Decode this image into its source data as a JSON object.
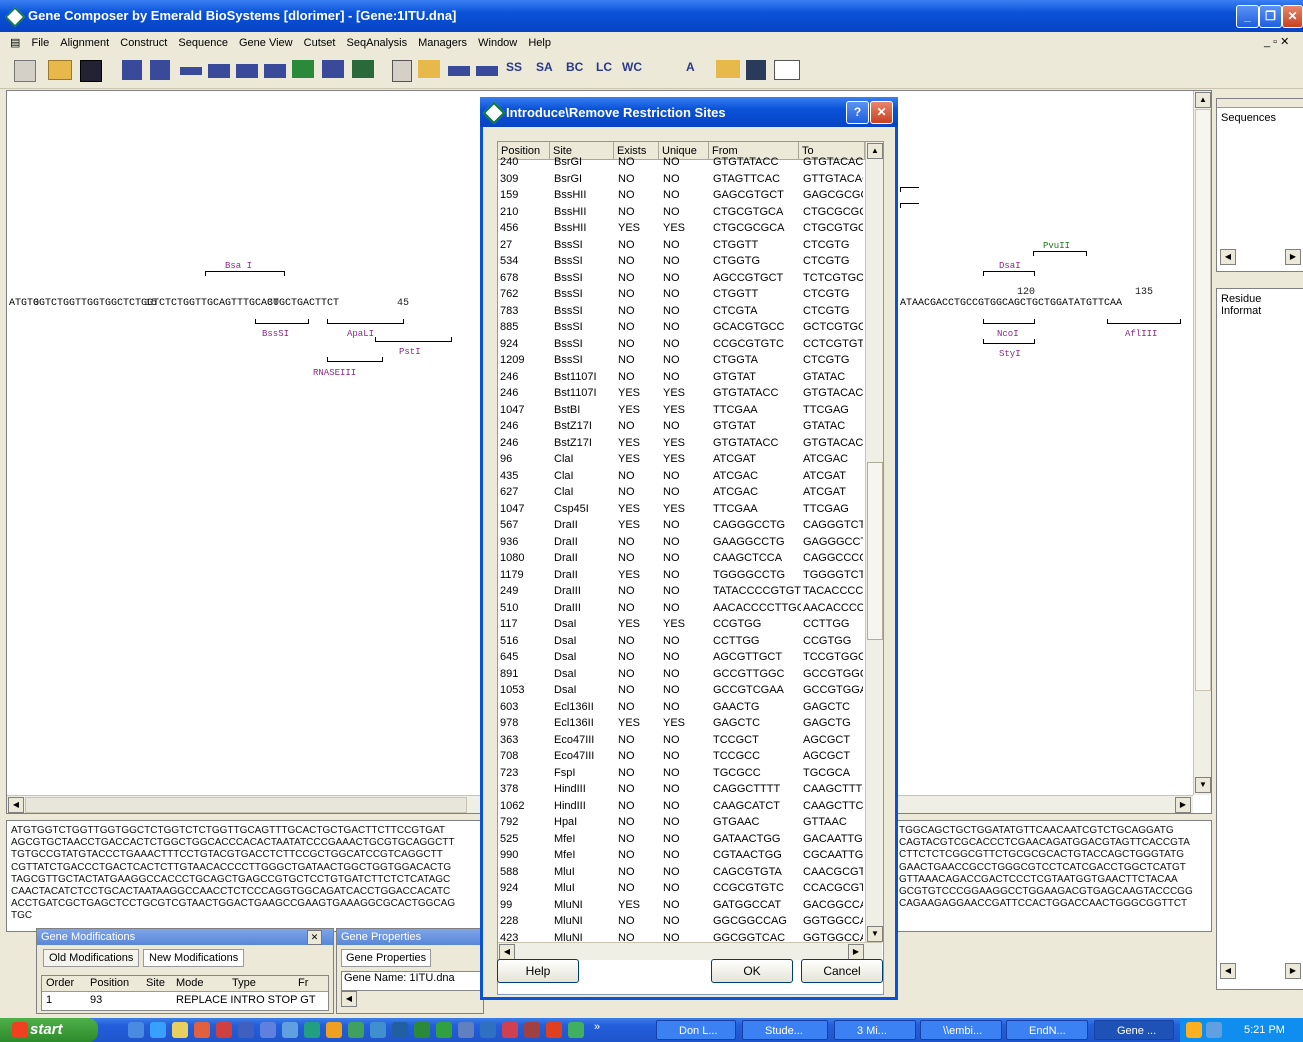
{
  "window": {
    "title": "Gene Composer by Emerald BioSystems [dlorimer] - [Gene:1ITU.dna]"
  },
  "menu": [
    "File",
    "Alignment",
    "Construct",
    "Sequence",
    "Gene View",
    "Cutset",
    "SeqAnalysis",
    "Managers",
    "Window",
    "Help"
  ],
  "toolbar_text": [
    "SS",
    "SA",
    "BC",
    "LC",
    "WC",
    "A"
  ],
  "sequence_view": {
    "sequence_left": "ATGTGGTCTGGTTGGTGGCTCTGGTCTCTGGTTGCAGTTTGCACTGCTGACTTCT",
    "sequence_right": "ATAACGACCTGCCGTGGCAGCTGCTGGATATGTTCAA",
    "ticks": [
      "0",
      "15",
      "30",
      "45",
      "120",
      "135"
    ],
    "sites": [
      "Bsa I",
      "BssSI",
      "ApaLI",
      "PstI",
      "RNASEIII",
      "PvuII",
      "DsaI",
      "NcoI",
      "StyI",
      "AflIII"
    ]
  },
  "right_panels": {
    "sequences": "Sequences",
    "residue": "Residue Informat"
  },
  "dna_lines_left": [
    "ATGTGGTCTGGTTGGTGGCTCTGGTCTCTGGTTGCAGTTTGCACTGCTGACTTCTTCCGTGAT",
    "AGCGTGCTAACCTGACCACTCTGGCTGGCACCCACACTAATATCCCGAAACTGCGTGCAGGCTT",
    "TGTGCCGTATGTACCCTGAAACTTTCCTGTACGTGACCTCTTCCGCTGGCATCCGTCAGGCTT",
    "CGTTATCTGACCCTGACTCACTCTTGTAACACCCCTTGGGCTGATAACTGGCTGGTGGACACTG",
    "TAGCGTTGCTACTATGAAGGCCACCCTGCAGCTGAGCCGTGCTCCTGTGATCTTCTCTCATAGC",
    "CAACTACATCTCCTGCACTAATAAGGCCAACCTCTCCCAGGTGGCAGATCACCTGGACCACATC",
    "ACCTGATCGCTGAGCTCCTGCGTCGTAACTGGACTGAAGCCGAAGTGAAAGGCGCACTGGCAG",
    "TGC"
  ],
  "dna_lines_right": [
    "TGGCAGCTGCTGGATATGTTCAACAATCGTCTGCAGGATG",
    "CAGTACGTCGCACCCTCGAACAGATGGACGTAGTTCACCGTA",
    "CTTCTCTCGGCGTTCTGCGCGCACTGTACCAGCTGGGTATG",
    "GAACTGAACCGCCTGGGCGTCCTCATCGACCTGGCTCATGT",
    "GTTAAACAGACCGACTCCCTCGTAATGGTGAACTTCTACAA",
    "GCGTGTCCCGGAAGGCCTGGAAGACGTGAGCAAGTACCCGG",
    "CAGAAGAGGAACCGATTCCACTGGACCAACTGGGCGGTTCT"
  ],
  "dialog": {
    "title": "Introduce\\Remove Restriction Sites",
    "columns": [
      "Position",
      "Site",
      "Exists",
      "Unique",
      "From",
      "To"
    ],
    "rows": [
      [
        "240",
        "BsrGI",
        "NO",
        "NO",
        "GTGTATACC",
        "GTGTACACC"
      ],
      [
        "309",
        "BsrGI",
        "NO",
        "NO",
        "GTAGTTCAC",
        "GTTGTACAC"
      ],
      [
        "159",
        "BssHII",
        "NO",
        "NO",
        "GAGCGTGCT",
        "GAGCGCGC"
      ],
      [
        "210",
        "BssHII",
        "NO",
        "NO",
        "CTGCGTGCA",
        "CTGCGCGC"
      ],
      [
        "456",
        "BssHII",
        "YES",
        "YES",
        "CTGCGCGCA",
        "CTGCGTGC"
      ],
      [
        "27",
        "BssSI",
        "NO",
        "NO",
        "CTGGTT",
        "CTCGTG"
      ],
      [
        "534",
        "BssSI",
        "NO",
        "NO",
        "CTGGTG",
        "CTCGTG"
      ],
      [
        "678",
        "BssSI",
        "NO",
        "NO",
        "AGCCGTGCT",
        "TCTCGTGC"
      ],
      [
        "762",
        "BssSI",
        "NO",
        "NO",
        "CTGGTT",
        "CTCGTG"
      ],
      [
        "783",
        "BssSI",
        "NO",
        "NO",
        "CTCGTA",
        "CTCGTG"
      ],
      [
        "885",
        "BssSI",
        "NO",
        "NO",
        "GCACGTGCC",
        "GCTCGTGC"
      ],
      [
        "924",
        "BssSI",
        "NO",
        "NO",
        "CCGCGTGTC",
        "CCTCGTGT"
      ],
      [
        "1209",
        "BssSI",
        "NO",
        "NO",
        "CTGGTA",
        "CTCGTG"
      ],
      [
        "246",
        "Bst1107I",
        "NO",
        "NO",
        "GTGTAT",
        "GTATAC"
      ],
      [
        "246",
        "Bst1107I",
        "YES",
        "YES",
        "GTGTATACC",
        "GTGTACACC"
      ],
      [
        "1047",
        "BstBI",
        "YES",
        "YES",
        "TTCGAA",
        "TTCGAG"
      ],
      [
        "246",
        "BstZ17I",
        "NO",
        "NO",
        "GTGTAT",
        "GTATAC"
      ],
      [
        "246",
        "BstZ17I",
        "YES",
        "YES",
        "GTGTATACC",
        "GTGTACACC"
      ],
      [
        "96",
        "ClaI",
        "YES",
        "YES",
        "ATCGAT",
        "ATCGAC"
      ],
      [
        "435",
        "ClaI",
        "NO",
        "NO",
        "ATCGAC",
        "ATCGAT"
      ],
      [
        "627",
        "ClaI",
        "NO",
        "NO",
        "ATCGAC",
        "ATCGAT"
      ],
      [
        "1047",
        "Csp45I",
        "YES",
        "YES",
        "TTCGAA",
        "TTCGAG"
      ],
      [
        "567",
        "DraII",
        "YES",
        "NO",
        "CAGGGCCTG",
        "CAGGGTCTC"
      ],
      [
        "936",
        "DraII",
        "NO",
        "NO",
        "GAAGGCCTG",
        "GAGGGCCTC"
      ],
      [
        "1080",
        "DraII",
        "NO",
        "NO",
        "CAAGCTCCA",
        "CAGGCCCCC"
      ],
      [
        "1179",
        "DraII",
        "YES",
        "NO",
        "TGGGGCCTG",
        "TGGGGTCTC"
      ],
      [
        "249",
        "DraIII",
        "NO",
        "NO",
        "TATACCCCGTGT",
        "TACACCCCG"
      ],
      [
        "510",
        "DraIII",
        "NO",
        "NO",
        "AACACCCCTTGG",
        "AACACCCCG"
      ],
      [
        "117",
        "DsaI",
        "YES",
        "YES",
        "CCGTGG",
        "CCTTGG"
      ],
      [
        "516",
        "DsaI",
        "NO",
        "NO",
        "CCTTGG",
        "CCGTGG"
      ],
      [
        "645",
        "DsaI",
        "NO",
        "NO",
        "AGCGTTGCT",
        "TCCGTGGC"
      ],
      [
        "891",
        "DsaI",
        "NO",
        "NO",
        "GCCGTTGGC",
        "GCCGTGGG"
      ],
      [
        "1053",
        "DsaI",
        "NO",
        "NO",
        "GCCGTCGAA",
        "GCCGTGGA"
      ],
      [
        "603",
        "Ecl136II",
        "NO",
        "NO",
        "GAACTG",
        "GAGCTC"
      ],
      [
        "978",
        "Ecl136II",
        "YES",
        "YES",
        "GAGCTC",
        "GAGCTG"
      ],
      [
        "363",
        "Eco47III",
        "NO",
        "NO",
        "TCCGCT",
        "AGCGCT"
      ],
      [
        "708",
        "Eco47III",
        "NO",
        "NO",
        "TCCGCC",
        "AGCGCT"
      ],
      [
        "723",
        "FspI",
        "NO",
        "NO",
        "TGCGCC",
        "TGCGCA"
      ],
      [
        "378",
        "HindIII",
        "NO",
        "NO",
        "CAGGCTTTT",
        "CAAGCTTTC"
      ],
      [
        "1062",
        "HindIII",
        "NO",
        "NO",
        "CAAGCATCT",
        "CAAGCTTCC"
      ],
      [
        "792",
        "HpaI",
        "NO",
        "NO",
        "GTGAAC",
        "GTTAAC"
      ],
      [
        "525",
        "MfeI",
        "NO",
        "NO",
        "GATAACTGG",
        "GACAATTGC"
      ],
      [
        "990",
        "MfeI",
        "NO",
        "NO",
        "CGTAACTGG",
        "CGCAATTGC"
      ],
      [
        "588",
        "MluI",
        "NO",
        "NO",
        "CAGCGTGTA",
        "CAACGCGT"
      ],
      [
        "924",
        "MluI",
        "NO",
        "NO",
        "CCGCGTGTC",
        "CCACGCGT"
      ],
      [
        "99",
        "MluNI",
        "YES",
        "NO",
        "GATGGCCAT",
        "GACGGCCA"
      ],
      [
        "228",
        "MluNI",
        "NO",
        "NO",
        "GGCGGCCAG",
        "GGTGGCCAC"
      ],
      [
        "423",
        "MluNI",
        "NO",
        "NO",
        "GGCGGTCAC",
        "GGTGGCCAC"
      ]
    ],
    "buttons": {
      "help": "Help",
      "ok": "OK",
      "cancel": "Cancel"
    }
  },
  "gene_mods": {
    "title": "Gene Modifications",
    "tabs": [
      "Old Modifications",
      "New Modifications"
    ],
    "columns": [
      "Order",
      "Position",
      "Site",
      "Mode",
      "Type",
      "Fr"
    ],
    "row": {
      "order": "1",
      "position": "93",
      "mode_type": "REPLACE INTRO STOP GT"
    }
  },
  "gene_props": {
    "title": "Gene Properties",
    "tab": "Gene Properties",
    "name": "Gene Name: 1ITU.dna"
  },
  "taskbar": {
    "start": "start",
    "tasks": [
      "Don L...",
      "Stude...",
      "3 Mi...",
      "\\\\embi...",
      "EndN...",
      "Gene ..."
    ],
    "clock": "5:21 PM"
  }
}
